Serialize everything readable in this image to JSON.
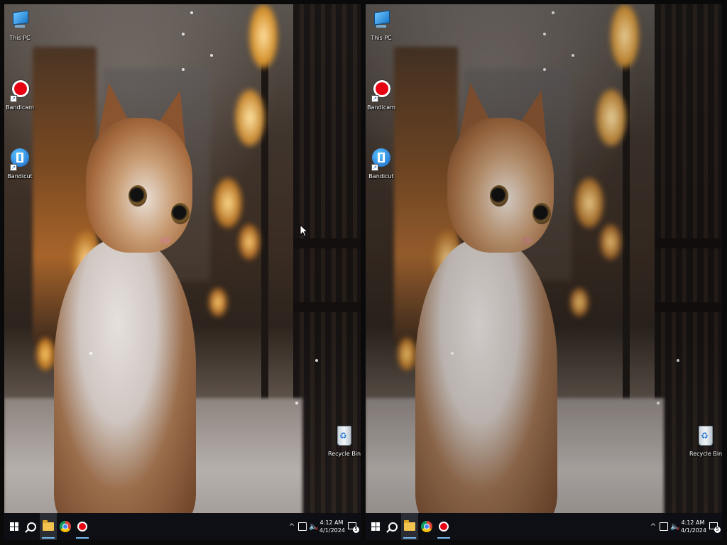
{
  "desktop_icons": [
    {
      "label": "This PC",
      "icon": "this-pc-icon"
    },
    {
      "label": "Bandicam",
      "icon": "bandicam-icon"
    },
    {
      "label": "Bandicut",
      "icon": "bandicut-icon"
    },
    {
      "label": "Recycle Bin",
      "icon": "recycle-bin-icon"
    }
  ],
  "taskbar": {
    "items": [
      {
        "icon": "windows-start-icon"
      },
      {
        "icon": "search-icon"
      },
      {
        "icon": "file-explorer-icon"
      },
      {
        "icon": "chrome-icon"
      },
      {
        "icon": "bandicam-taskbar-icon"
      }
    ],
    "tray": {
      "chevron": "^",
      "time": "4:12 AM",
      "date": "4/1/2024",
      "notification_count": "5"
    }
  },
  "colors": {
    "taskbar_bg": "#0d0f14",
    "active_indicator": "#76b9ed",
    "bandicam_red": "#e60012"
  }
}
